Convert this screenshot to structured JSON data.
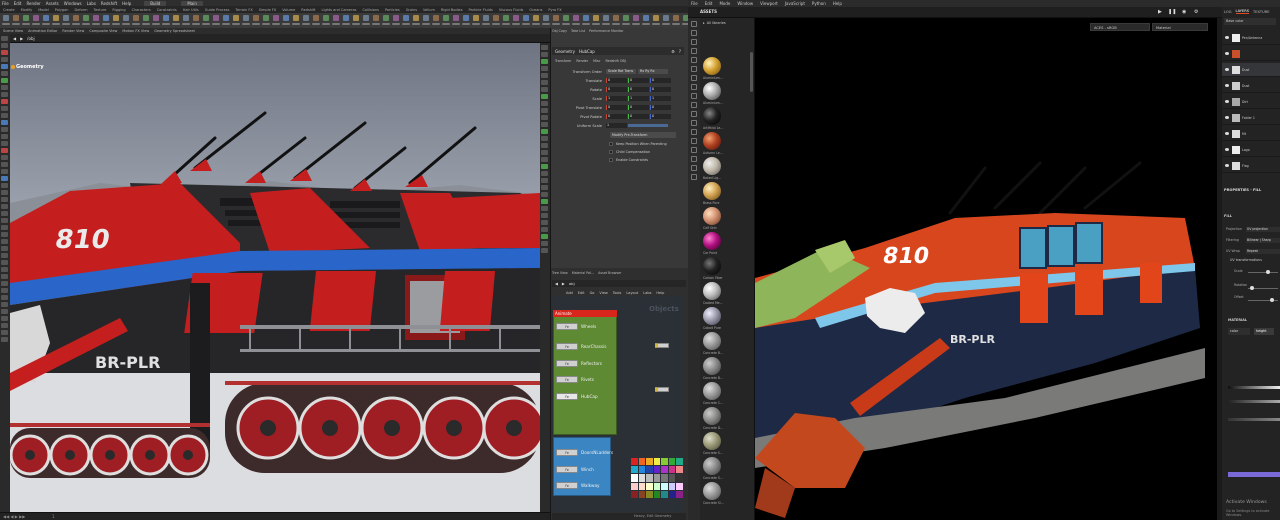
{
  "houdini": {
    "menubar": [
      "File",
      "Edit",
      "Render",
      "Assets",
      "Windows",
      "Labs",
      "Redshift",
      "Help"
    ],
    "build_badge": "Build",
    "main_badge": "Main",
    "shelf_tabs": [
      "Create",
      "Modify",
      "Model",
      "Polygon",
      "Deform",
      "Texture",
      "Rigging",
      "Characters",
      "Constraints",
      "Hair Utils",
      "Guide Process",
      "Terrain FX",
      "Simple FX",
      "Volume",
      "Redshift",
      "Lights and Cameras",
      "Collisions",
      "Particles",
      "Grains",
      "Vellum",
      "Rigid Bodies",
      "Particle Fluids",
      "Viscous Fluids",
      "Oceans",
      "Pyro FX",
      "FEM",
      "Wires",
      "Crowds",
      "Drive Simulation"
    ],
    "pane_tabs": [
      "Scene View",
      "Animation Editor",
      "Render View",
      "Composite View",
      "Motion FX View",
      "Geometry Spreadsheet"
    ],
    "path": "/obj",
    "viewport_label": "Geometry",
    "timeline_frame": "1"
  },
  "params": {
    "pane_tabs": [
      "Obj Copy",
      "Take List",
      "Performance Monitor"
    ],
    "node_type": "Geometry",
    "node_name": "HubCap",
    "subtabs": [
      "Transform",
      "Render",
      "Misc",
      "Redshift OBJ"
    ],
    "transform_order_label": "Transform Order",
    "transform_order_value": "Scale Rot Trans",
    "rotate_order_value": "Rx Ry Rz",
    "rows": [
      {
        "label": "Translate",
        "x": "0",
        "y": "0",
        "z": "0"
      },
      {
        "label": "Rotate",
        "x": "0",
        "y": "0",
        "z": "0"
      },
      {
        "label": "Scale",
        "x": "1",
        "y": "1",
        "z": "1"
      },
      {
        "label": "Pivot Translate",
        "x": "0",
        "y": "0",
        "z": "0"
      },
      {
        "label": "Pivot Rotate",
        "x": "0",
        "y": "0",
        "z": "0"
      }
    ],
    "uniform_scale_label": "Uniform Scale",
    "uniform_scale_value": "1",
    "modify_button": "Modify Pre-Transform",
    "checks": [
      "Keep Position When Parenting",
      "Child Compensation",
      "Enable Constraints"
    ]
  },
  "network": {
    "pane_tabs": [
      "Tree View",
      "Material Pal...",
      "Asset Browser"
    ],
    "path": "obj",
    "menu": [
      "Add",
      "Edit",
      "Go",
      "View",
      "Tools",
      "Layout",
      "Labs",
      "Help"
    ],
    "watermark": "Objects",
    "group_name": "Animate",
    "node_icon": "Fe",
    "nodes": [
      "Wheels",
      "RearChassis",
      "Reflectors",
      "Rivets",
      "HubCap",
      "DoorsNLadders",
      "Winch",
      "Walkway"
    ],
    "status": "Heavy, Edit Geometry"
  },
  "painter": {
    "menubar": [
      "File",
      "Edit",
      "Mode",
      "Window",
      "Viewport",
      "JavaScript",
      "Python",
      "Help"
    ],
    "assets_title": "ASSETS",
    "library": "All libraries",
    "materials": [
      "Aluminium...",
      "Aluminium...",
      "Artificial Le...",
      "Autumn Le...",
      "Baked Lig...",
      "Brass Pure",
      "Calf Skin",
      "Car Paint",
      "Carbon Fiber",
      "Coated Me...",
      "Cobalt Pure",
      "Concrete B...",
      "Concrete B...",
      "Concrete C...",
      "Concrete D...",
      "Concrete S...",
      "Concrete S...",
      "Concrete Si..."
    ],
    "colorspace": "ACES - sRGB",
    "channel": "Material",
    "layer_tabs": [
      "LOG",
      "LAYERS",
      "TEXTURE"
    ],
    "blend": "Base color",
    "layers": [
      "Pen/Antenna",
      "",
      "Dust",
      "Dust",
      "Dirt",
      "Folder 1",
      "Mt",
      "Logo",
      "Flag"
    ],
    "props_title": "PROPERTIES - FILL",
    "fill_label": "FILL",
    "props": [
      {
        "k": "Projection",
        "v": "UV projection"
      },
      {
        "k": "Filtering",
        "v": "Bilinear | Sharp"
      },
      {
        "k": "UV Wrap",
        "v": "Repeat"
      }
    ],
    "uv_transform": "UV transformations",
    "scale_label": "Scale",
    "rotation_label": "Rotation",
    "offset_label": "Offset",
    "material_label": "MATERIAL",
    "color_button": "color",
    "height_button": "height",
    "activate_title": "Activate Windows",
    "activate_sub": "Go to Settings to activate Windows."
  },
  "colors": {
    "houdini_bg": "#383838",
    "painter_bg": "#000000",
    "accent_orange": "#e04a20",
    "net_group_green": "#5e8a34",
    "net_group_blue": "#3b86c2",
    "net_group_red": "#d9261c"
  }
}
